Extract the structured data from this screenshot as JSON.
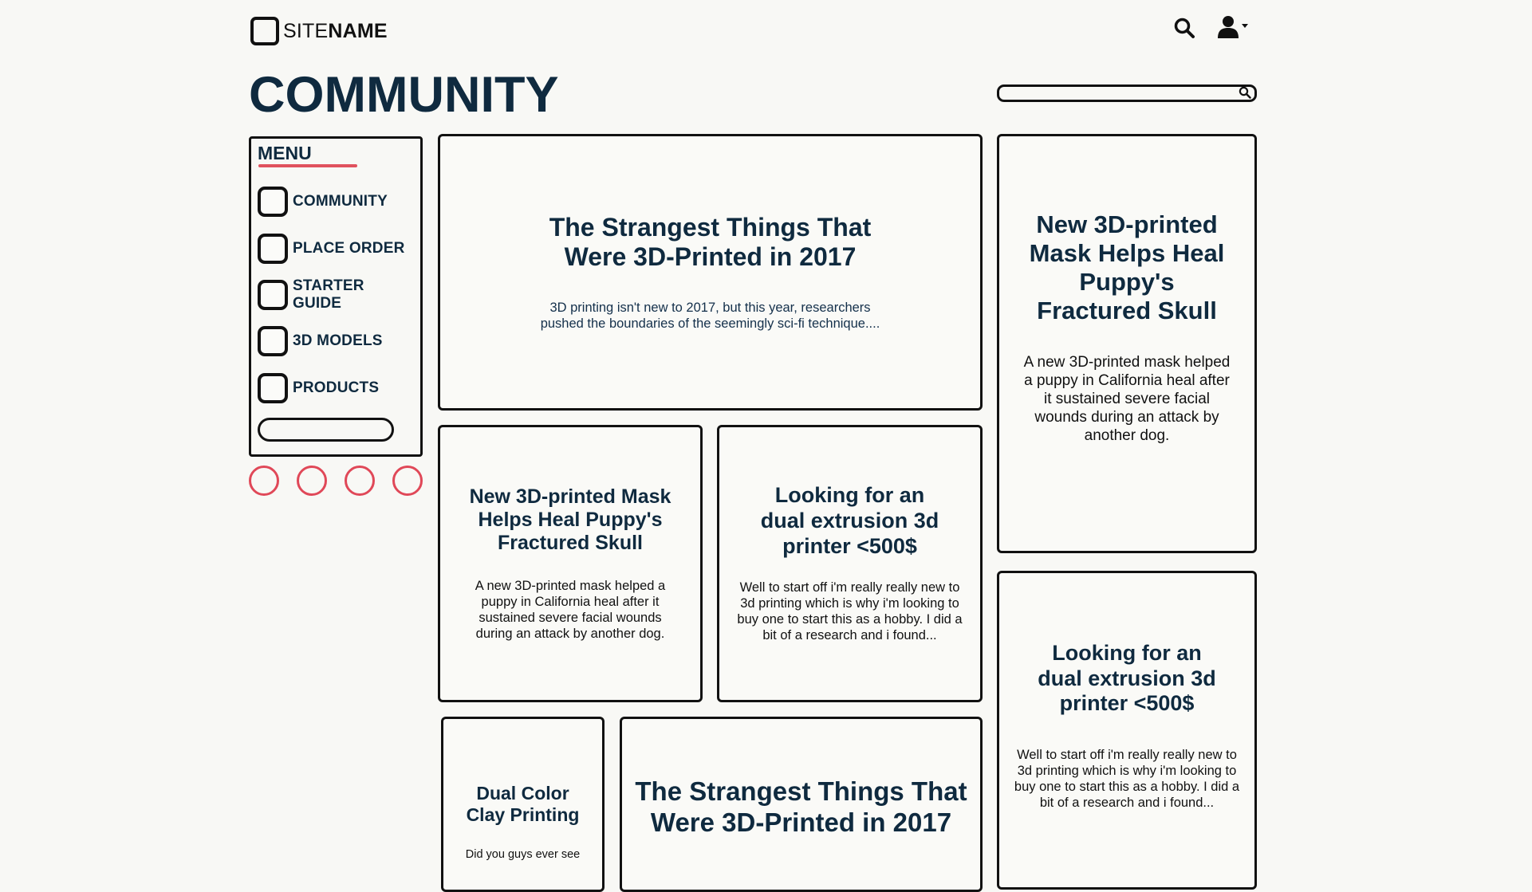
{
  "header": {
    "logo_light": "SITE",
    "logo_bold": "NAME",
    "search_icon": "search-icon",
    "user_icon": "user-icon"
  },
  "page": {
    "title": "COMMUNITY",
    "search_placeholder": ""
  },
  "menu": {
    "title": "MENU",
    "items": [
      {
        "label": "COMMUNITY"
      },
      {
        "label": "PLACE ORDER"
      },
      {
        "label": "STARTER GUIDE"
      },
      {
        "label": "3D MODELS"
      },
      {
        "label": "PRODUCTS"
      }
    ]
  },
  "pagination": {
    "count": 4,
    "color": "#e04858"
  },
  "cards": [
    {
      "title": "The Strangest Things That Were 3D-Printed in 2017",
      "text": "3D printing isn't new to 2017, but this year, researchers pushed the boundaries of the seemingly sci-fi technique...."
    },
    {
      "title": "New 3D-printed Mask Helps Heal Puppy's Fractured Skull",
      "text": "A new 3D-printed mask helped a puppy in California heal after it sustained severe facial wounds during an attack by another dog."
    },
    {
      "title": "New 3D-printed Mask Helps Heal Puppy's Fractured Skull",
      "text": "A new 3D-printed mask helped a puppy in California heal after it sustained severe facial wounds during an attack by another dog."
    },
    {
      "title": "Looking for an dual extrusion 3d printer <500$",
      "text": "Well to start off i'm really really new to 3d printing which is why i'm looking to buy one to start this as a hobby. I did a bit of a research and i found..."
    },
    {
      "title": "Looking for an dual extrusion 3d printer <500$",
      "text": "Well to start off i'm really really new to 3d printing which is why i'm looking to buy one to start this as a hobby. I did a bit of a research and i found..."
    },
    {
      "title": "Dual Color Clay Printing",
      "text": "Did you guys ever see"
    },
    {
      "title": "The Strangest Things That Were 3D-Printed in 2017",
      "text": ""
    }
  ],
  "colors": {
    "accent": "#e0525e",
    "heading": "#0f2a3f",
    "background": "#f8f8f5"
  }
}
